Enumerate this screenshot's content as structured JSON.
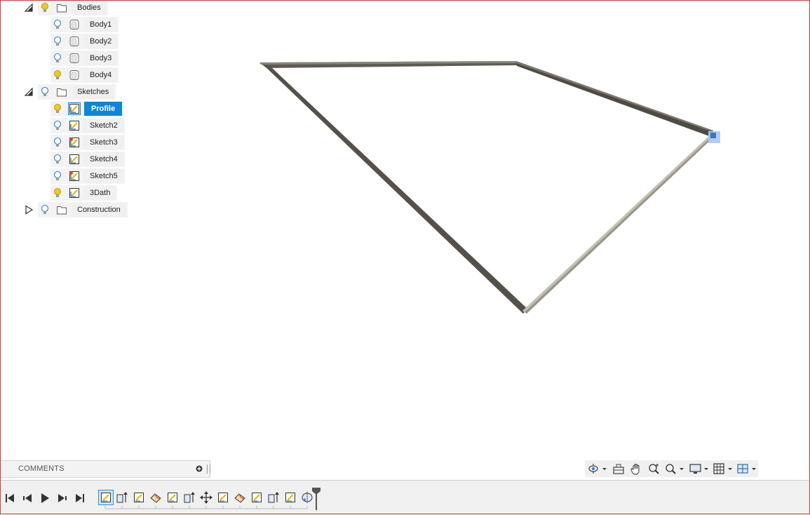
{
  "browser": {
    "folders": [
      {
        "name": "Bodies",
        "expanded": true,
        "light": "on"
      },
      {
        "name": "Sketches",
        "expanded": true,
        "light": "off"
      },
      {
        "name": "Construction",
        "expanded": false,
        "light": "off"
      }
    ],
    "bodies": [
      {
        "label": "Body1",
        "light": "off"
      },
      {
        "label": "Body2",
        "light": "off"
      },
      {
        "label": "Body3",
        "light": "off"
      },
      {
        "label": "Body4",
        "light": "on"
      }
    ],
    "sketches": [
      {
        "label": "Profile",
        "light": "on",
        "selected": true
      },
      {
        "label": "Sketch2",
        "light": "off"
      },
      {
        "label": "Sketch3",
        "light": "off"
      },
      {
        "label": "Sketch4",
        "light": "off"
      },
      {
        "label": "Sketch5",
        "light": "off"
      },
      {
        "label": "3Dath",
        "light": "on"
      }
    ]
  },
  "comments": {
    "label": "COMMENTS"
  },
  "navbar": {
    "icons": [
      "orbit-icon",
      "look-at-icon",
      "pan-icon",
      "zoom-icon",
      "fit-icon",
      "display-settings-icon",
      "grid-icon",
      "viewports-icon"
    ]
  },
  "timeline": {
    "playback": [
      "go-to-start-icon",
      "step-back-icon",
      "play-icon",
      "step-forward-icon",
      "go-to-end-icon"
    ],
    "features": [
      "sketch",
      "extrude",
      "sketch",
      "sweep",
      "sketch",
      "extrude",
      "move",
      "sketch",
      "sweep",
      "sketch",
      "extrude",
      "sketch",
      "revolve"
    ]
  }
}
